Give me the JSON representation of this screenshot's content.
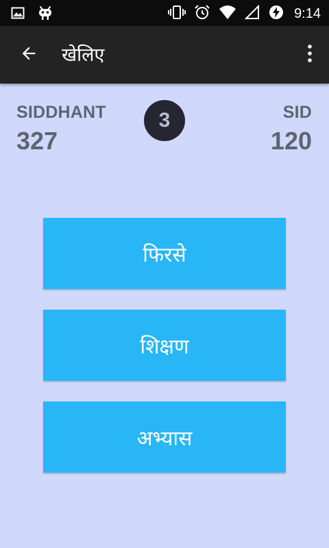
{
  "status_bar": {
    "time": "9:14",
    "icons": [
      "image-icon",
      "android-debug-icon",
      "vibrate-icon",
      "alarm-icon",
      "wifi-icon",
      "signal-icon",
      "battery-charging-icon"
    ]
  },
  "app_bar": {
    "title": "खेलिए",
    "back_icon": "arrow-back-icon",
    "menu_icon": "more-vert-icon"
  },
  "scoreboard": {
    "player1": {
      "name": "SIDDHANT",
      "score": "327"
    },
    "round": "3",
    "player2": {
      "name": "SID",
      "score": "120"
    }
  },
  "buttons": {
    "again": "फिरसे",
    "learn": "शिक्षण",
    "practice": "अभ्यास"
  },
  "colors": {
    "background": "#d0d9fb",
    "app_bar": "#232323",
    "button": "#29b6f6",
    "score_text": "#5f6472",
    "round_badge": "#262633"
  }
}
